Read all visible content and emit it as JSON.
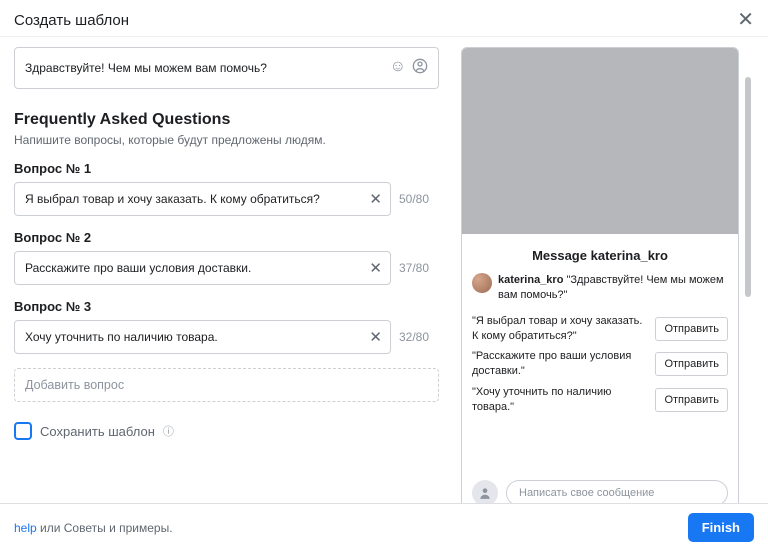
{
  "header": {
    "title": "Создать шаблон"
  },
  "greeting": {
    "text": "Здравствуйте! Чем мы можем вам помочь?"
  },
  "faq": {
    "title": "Frequently Asked Questions",
    "subtitle": "Напишите вопросы, которые будут предложены людям.",
    "max": 80,
    "questions": [
      {
        "label": "Вопрос № 1",
        "text": "Я выбрал товар и хочу заказать. К кому обратиться?",
        "count": "50/80"
      },
      {
        "label": "Вопрос № 2",
        "text": "Расскажите про ваши условия доставки.",
        "count": "37/80"
      },
      {
        "label": "Вопрос № 3",
        "text": "Хочу уточнить по наличию товара.",
        "count": "32/80"
      }
    ],
    "add_label": "Добавить вопрос",
    "save_label": "Сохранить шаблон"
  },
  "preview": {
    "message_prefix": "Message",
    "username": "katerina_kro",
    "greeting": "\"Здравствуйте! Чем мы можем вам помочь?\"",
    "send_label": "Отправить",
    "questions": [
      "\"Я выбрал товар и хочу заказать. К кому обратиться?\"",
      "\"Расскажите про ваши условия доставки.\"",
      "\"Хочу уточнить по наличию товара.\""
    ],
    "input_placeholder": "Написать свое сообщение"
  },
  "footer": {
    "help": "help",
    "rest": " или Советы и примеры.",
    "finish": "Finish"
  }
}
